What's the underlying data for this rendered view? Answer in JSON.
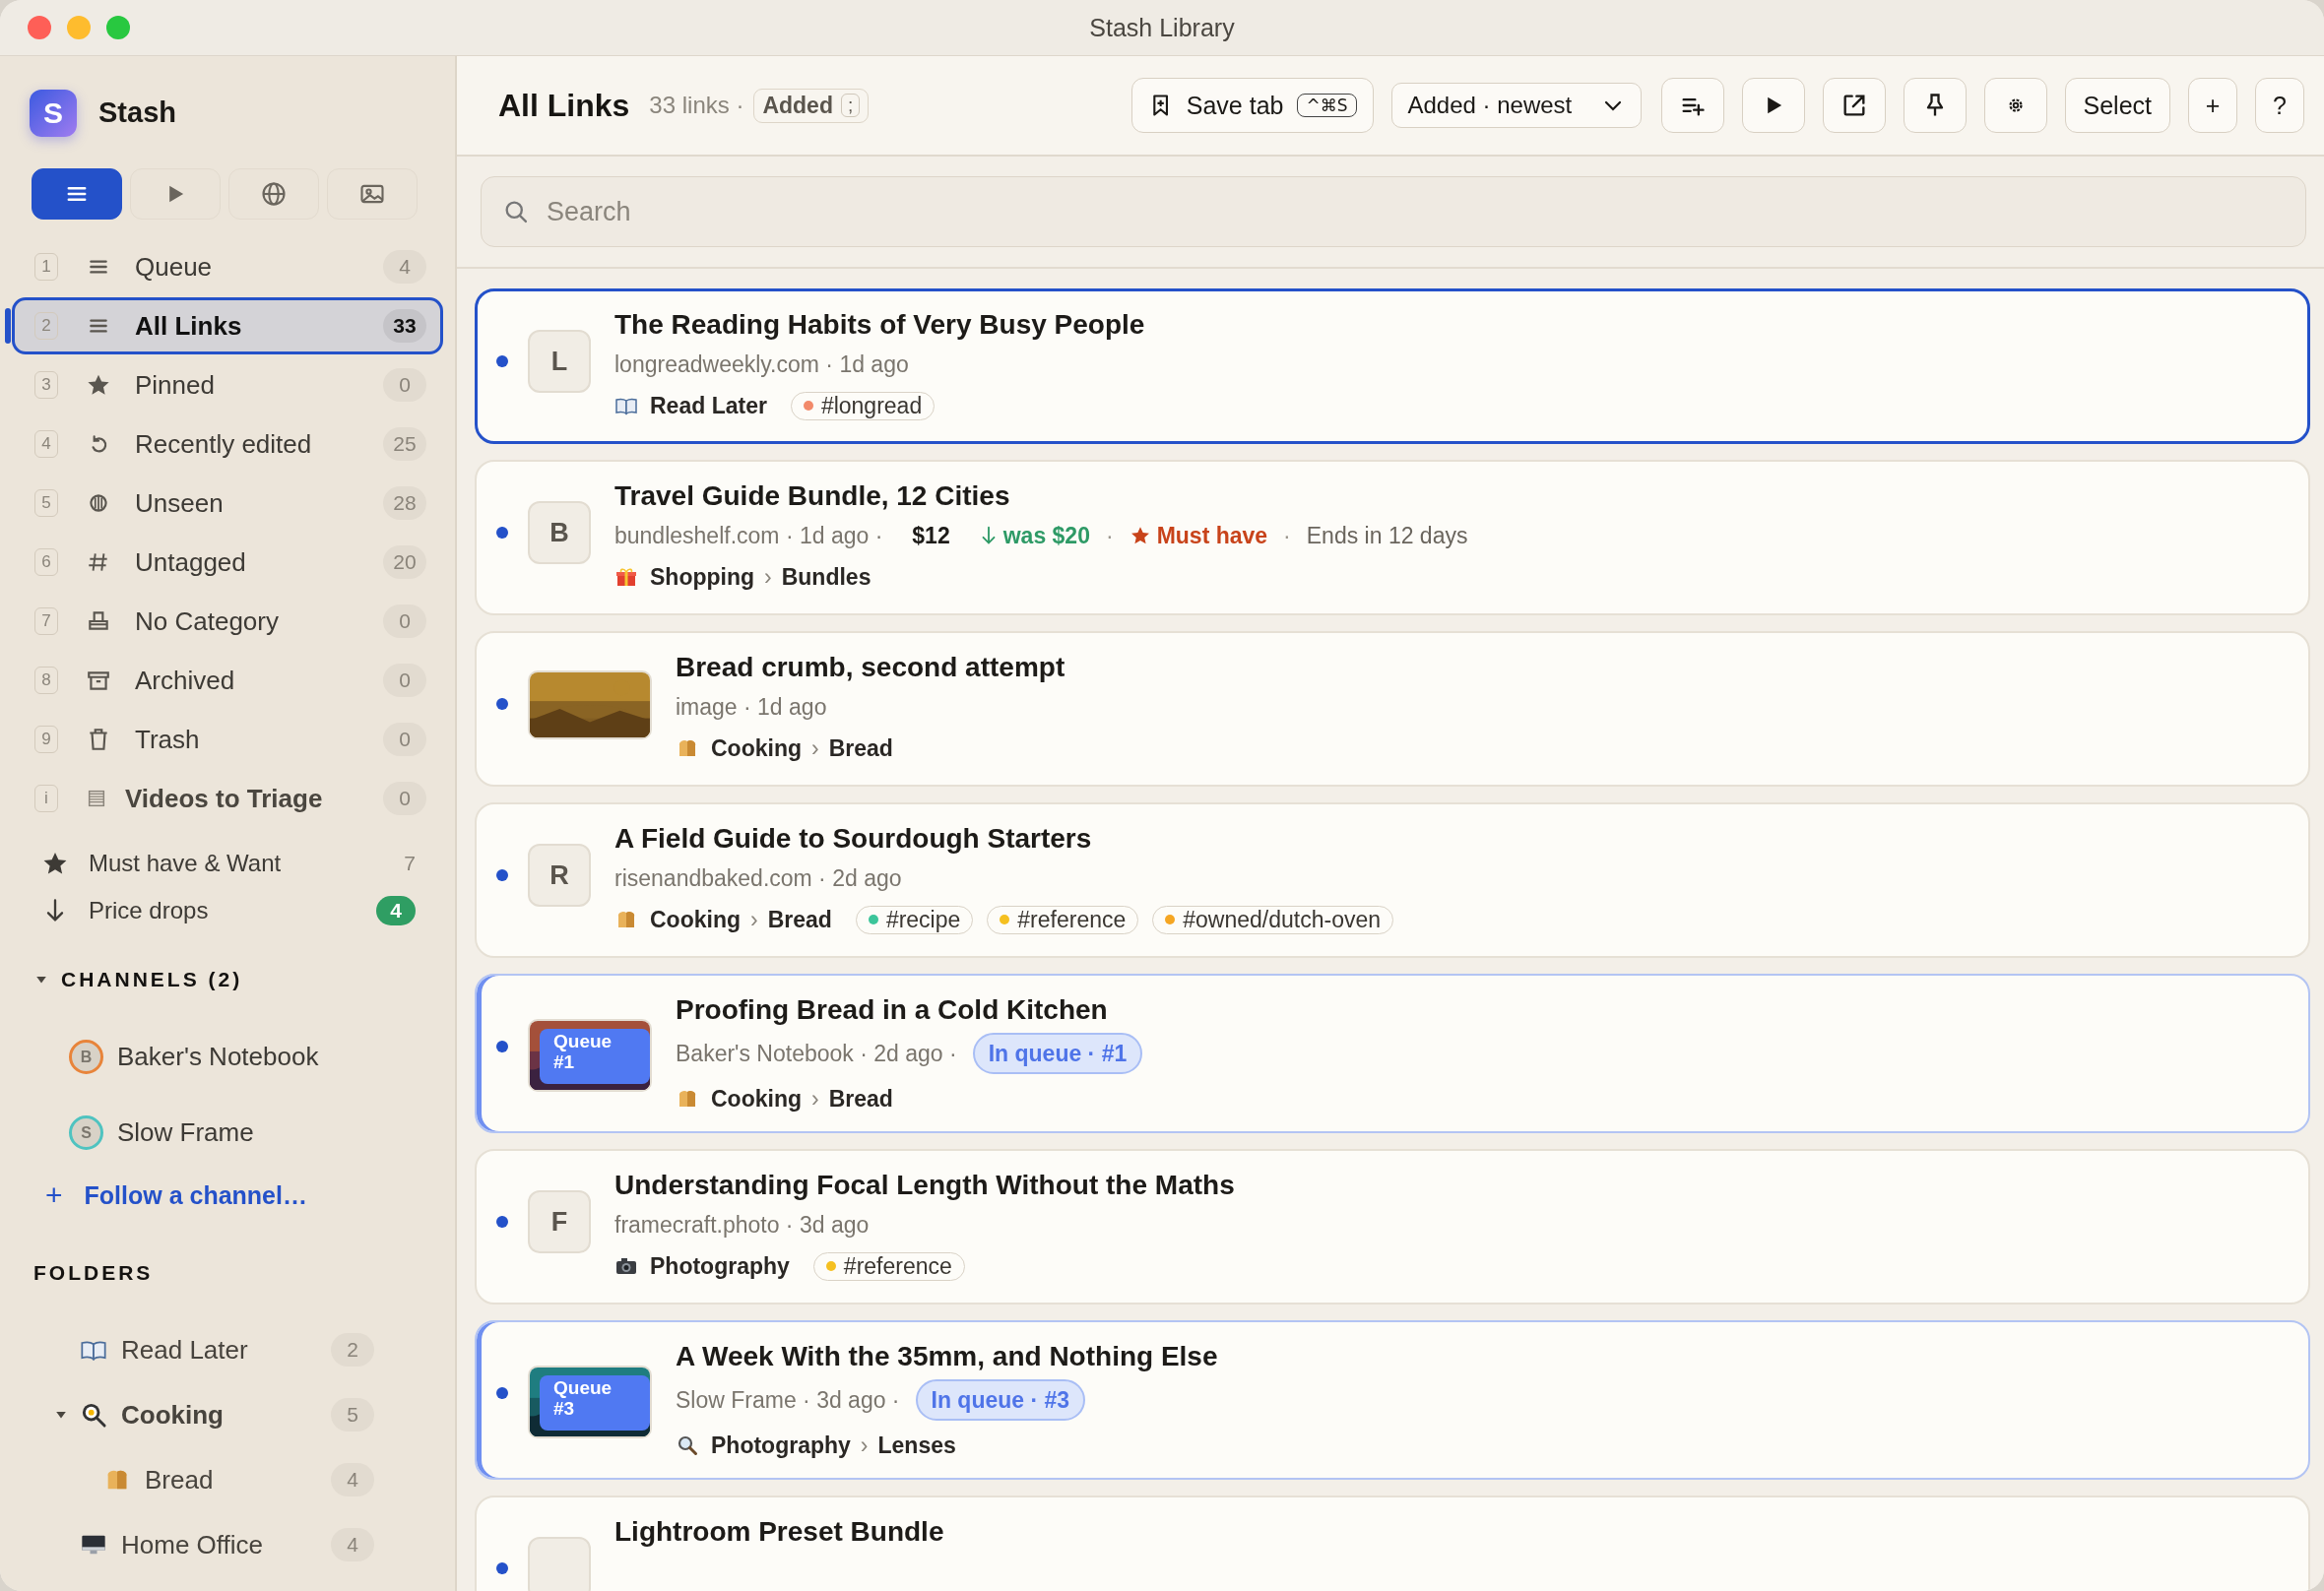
{
  "window": {
    "title": "Stash Library"
  },
  "sidebar": {
    "app": {
      "logo": "S",
      "name": "Stash"
    },
    "views": [
      {
        "selected": true
      },
      {
        "selected": false
      },
      {
        "selected": false
      },
      {
        "selected": false
      }
    ],
    "nav": [
      {
        "key": "1",
        "label": "Queue",
        "count": "4",
        "kind": "view",
        "selected": false
      },
      {
        "key": "2",
        "label": "All Links",
        "count": "33",
        "kind": "view",
        "selected": true
      },
      {
        "key": "3",
        "label": "Pinned",
        "count": "0",
        "kind": "view",
        "selected": false
      },
      {
        "key": "4",
        "label": "Recently edited",
        "count": "25",
        "kind": "view",
        "selected": false
      },
      {
        "key": "5",
        "label": "Unseen",
        "count": "28",
        "kind": "view",
        "selected": false
      },
      {
        "key": "6",
        "label": "Untagged",
        "count": "20",
        "kind": "view",
        "selected": false
      },
      {
        "key": "7",
        "label": "No Category",
        "count": "0",
        "kind": "view",
        "selected": false
      },
      {
        "key": "8",
        "label": "Archived",
        "count": "0",
        "kind": "view",
        "selected": false
      },
      {
        "key": "9",
        "label": "Trash",
        "count": "0",
        "kind": "view",
        "selected": false
      },
      {
        "key": "i",
        "label": "Videos to Triage",
        "count": "0",
        "kind": "playlist",
        "selected": false
      }
    ],
    "smart": [
      {
        "label": "Must have & Want",
        "count": "7",
        "alert": false
      },
      {
        "label": "Price drops",
        "count": "4",
        "alert": true
      }
    ],
    "channels": {
      "title": "CHANNELS (2)",
      "expanded": true,
      "items": [
        {
          "letter": "B",
          "name": "Baker's Notebook",
          "color": "#e8843a"
        },
        {
          "letter": "S",
          "name": "Slow Frame",
          "color": "#4fc3c0"
        }
      ],
      "follow": {
        "symbol": "+",
        "label": "Follow a channel…"
      }
    },
    "folders": {
      "title": "FOLDERS",
      "items": [
        {
          "label": "Read Later",
          "count": "2"
        },
        {
          "label": "Cooking",
          "count": "5",
          "expanded": true,
          "children": [
            {
              "label": "Bread",
              "count": "4"
            }
          ]
        },
        {
          "label": "Home Office",
          "count": "4"
        }
      ]
    }
  },
  "toolbar": {
    "title": "All Links",
    "count": "33 links ·",
    "sort_chip": "Added",
    "sort_key": ";",
    "save": {
      "label": "Save tab",
      "shortcut": "^⌘S"
    },
    "sort_select": "Added · newest",
    "actions": [
      {
        "kind": "icon"
      },
      {
        "kind": "icon"
      },
      {
        "kind": "icon"
      },
      {
        "kind": "icon"
      },
      {
        "kind": "icon"
      },
      {
        "kind": "text",
        "label": "Select"
      },
      {
        "kind": "text",
        "label": "+"
      },
      {
        "kind": "text",
        "label": "?"
      }
    ]
  },
  "search": {
    "placeholder": "Search"
  },
  "items": [
    {
      "unread": true,
      "selected": true,
      "queued": false,
      "thumb": {
        "kind": "letter",
        "letter": "L"
      },
      "title": "The Reading Habits of Very Busy People",
      "meta": "longreadweekly.com · 1d ago",
      "path": [
        "Read Later"
      ],
      "tags": [
        {
          "label": "#longread",
          "color": "#f28a6a"
        }
      ]
    },
    {
      "unread": true,
      "selected": false,
      "queued": false,
      "thumb": {
        "kind": "letter",
        "letter": "B"
      },
      "title": "Travel Guide Bundle, 12 Cities",
      "meta": "bundleshelf.com · 1d ago ·",
      "extras": [
        {
          "kind": "price",
          "text": "$12"
        },
        {
          "kind": "drop",
          "text": "was $20"
        },
        {
          "kind": "sep",
          "text": "·"
        },
        {
          "kind": "must",
          "text": "Must have"
        },
        {
          "kind": "sep",
          "text": "·"
        },
        {
          "kind": "note",
          "text": "Ends in 12 days"
        }
      ],
      "path": [
        "Shopping",
        "›",
        "Bundles"
      ]
    },
    {
      "unread": true,
      "selected": false,
      "queued": false,
      "thumb": {
        "kind": "picture"
      },
      "title": "Bread crumb, second attempt",
      "meta": "image · 1d ago",
      "path": [
        "Cooking",
        "›",
        "Bread"
      ]
    },
    {
      "unread": true,
      "selected": false,
      "queued": false,
      "thumb": {
        "kind": "letter",
        "letter": "R"
      },
      "title": "A Field Guide to Sourdough Starters",
      "meta": "risenandbaked.com · 2d ago",
      "path": [
        "Cooking",
        "›",
        "Bread"
      ],
      "tags": [
        {
          "label": "#recipe",
          "color": "#3cc59a"
        },
        {
          "label": "#reference",
          "color": "#f5c020"
        },
        {
          "label": "#owned/dutch-oven",
          "color": "#f5a623"
        }
      ]
    },
    {
      "unread": true,
      "selected": false,
      "queued": true,
      "thumb": {
        "kind": "queue",
        "badge": "Queue #1"
      },
      "title": "Proofing Bread in a Cold Kitchen",
      "meta": "Baker's Notebook · 2d ago ·",
      "extras": [
        {
          "kind": "queue",
          "text": "In queue · #1"
        }
      ],
      "path": [
        "Cooking",
        "›",
        "Bread"
      ]
    },
    {
      "unread": true,
      "selected": false,
      "queued": false,
      "thumb": {
        "kind": "letter",
        "letter": "F"
      },
      "title": "Understanding Focal Length Without the Maths",
      "meta": "framecraft.photo · 3d ago",
      "path": [
        "Photography"
      ],
      "tags": [
        {
          "label": "#reference",
          "color": "#f5c020"
        }
      ]
    },
    {
      "unread": true,
      "selected": false,
      "queued": true,
      "thumb": {
        "kind": "queue",
        "badge": "Queue #3"
      },
      "title": "A Week With the 35mm, and Nothing Else",
      "meta": "Slow Frame · 3d ago ·",
      "extras": [
        {
          "kind": "queue",
          "text": "In queue · #3"
        }
      ],
      "path": [
        "Photography",
        "›",
        "Lenses"
      ]
    },
    {
      "unread": true,
      "selected": false,
      "queued": false,
      "thumb": {
        "kind": "blank"
      },
      "title": "Lightroom Preset Bundle"
    }
  ]
}
